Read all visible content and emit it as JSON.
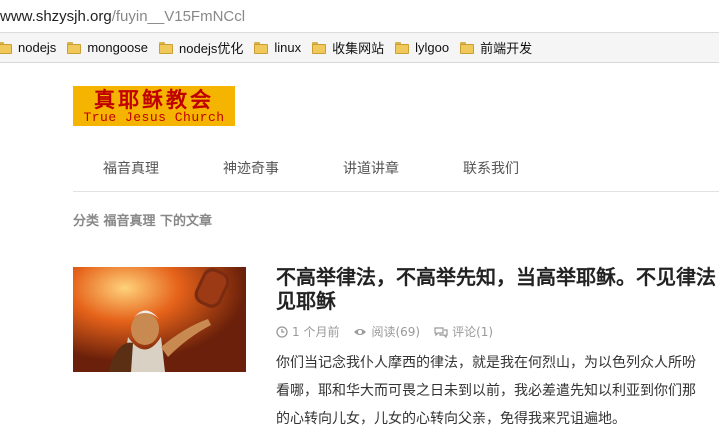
{
  "browser": {
    "url_domain": "www.shzysjh.org",
    "url_path": "/fuyin__V15FmNCcl",
    "bookmarks": [
      {
        "label": "nodejs"
      },
      {
        "label": "mongoose"
      },
      {
        "label": "nodejs优化"
      },
      {
        "label": "linux"
      },
      {
        "label": "收集网站"
      },
      {
        "label": "lylgoo"
      },
      {
        "label": "前端开发"
      }
    ]
  },
  "logo": {
    "chinese": "真耶稣教会",
    "english": "True Jesus Church"
  },
  "nav": [
    {
      "label": "福音真理"
    },
    {
      "label": "神迹奇事"
    },
    {
      "label": "讲道讲章"
    },
    {
      "label": "联系我们"
    }
  ],
  "category_heading": "分类 福音真理 下的文章",
  "post": {
    "title_line1": "不高举律法，不高举先知，当高举耶稣。不见律法",
    "title_line2": "见耶稣",
    "time": "1 个月前",
    "views": "阅读(69)",
    "comments": "评论(1)",
    "excerpt_lines": [
      "你们当记念我仆人摩西的律法，就是我在何烈山，为以色列众人所吩",
      "看哪，耶和华大而可畏之日未到以前，我必差遣先知以利亚到你们那",
      "的心转向儿女，儿女的心转向父亲，免得我来咒诅遍地。"
    ]
  },
  "colors": {
    "logo_bg": "#f5b400",
    "logo_text": "#c00000",
    "nav_text": "#555555",
    "meta_text": "#999999"
  }
}
